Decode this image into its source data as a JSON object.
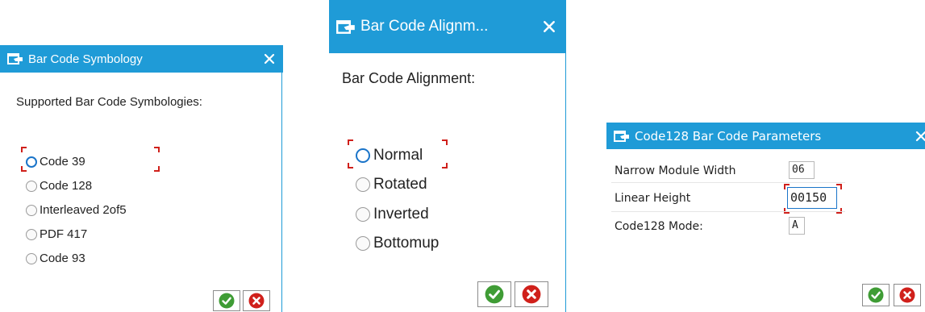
{
  "colors": {
    "title_bar": "#1f9bd7",
    "radio_selected": "#1a74c9",
    "focus_marker": "#d0201b",
    "ok_button": "#3f9c35",
    "cancel_button": "#d0201b"
  },
  "dialogs": {
    "symbology": {
      "title": "Bar Code Symbology",
      "prompt": "Supported Bar Code Symbologies:",
      "options": [
        {
          "label": "Code 39",
          "selected": true
        },
        {
          "label": "Code 128",
          "selected": false
        },
        {
          "label": "Interleaved 2of5",
          "selected": false
        },
        {
          "label": "PDF 417",
          "selected": false
        },
        {
          "label": "Code 93",
          "selected": false
        }
      ]
    },
    "alignment": {
      "title": "Bar Code Alignm...",
      "prompt": "Bar Code Alignment:",
      "options": [
        {
          "label": "Normal",
          "selected": true
        },
        {
          "label": "Rotated",
          "selected": false
        },
        {
          "label": "Inverted",
          "selected": false
        },
        {
          "label": "Bottomup",
          "selected": false
        }
      ]
    },
    "code128": {
      "title": "Code128 Bar Code Parameters",
      "fields": [
        {
          "label": "Narrow Module Width",
          "value": "06"
        },
        {
          "label": "Linear Height",
          "value": "00150"
        },
        {
          "label": "Code128 Mode:",
          "value": "A"
        }
      ]
    }
  },
  "icons": {
    "title": "dialog-window-icon",
    "close": "close-icon",
    "ok": "checkmark-icon",
    "cancel": "cancel-icon"
  }
}
